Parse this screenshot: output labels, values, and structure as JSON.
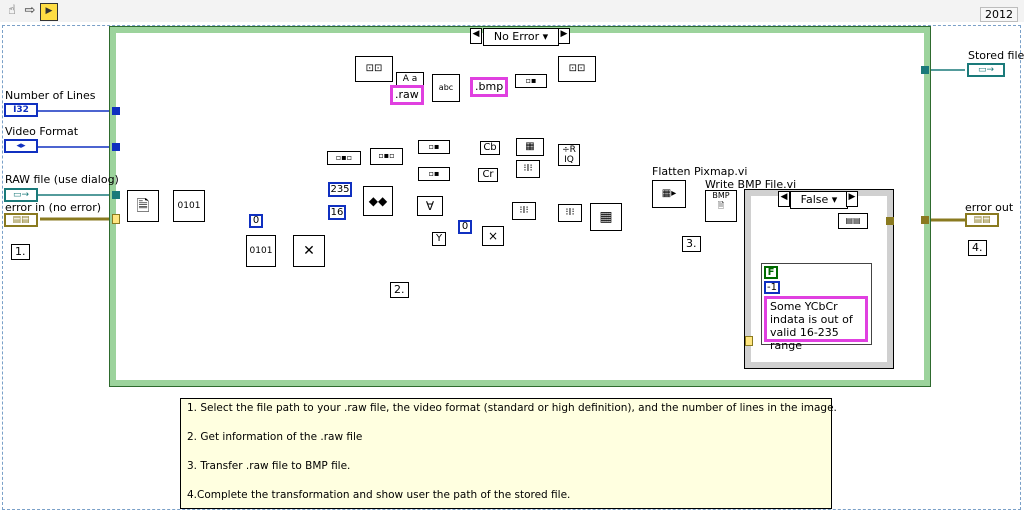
{
  "toolbar": {
    "version": "2012",
    "icons": [
      "hand-tool-icon",
      "arrow-right-icon",
      "run-icon"
    ]
  },
  "controls": {
    "number_of_lines": {
      "label": "Number of Lines",
      "type": "I32"
    },
    "video_format": {
      "label": "Video Format"
    },
    "raw_file": {
      "label": "RAW file (use dialog)"
    },
    "error_in": {
      "label": "error in (no error)"
    }
  },
  "indicators": {
    "stored_file": {
      "label": "Stored file"
    },
    "error_out": {
      "label": "error out"
    }
  },
  "case_structure": {
    "selector": "No Error",
    "step_label": "2."
  },
  "inner_case": {
    "selector": "False",
    "bool_const": "F",
    "num_const": "-1",
    "message": "Some YCbCr indata is out of valid 16-235 range"
  },
  "constants": {
    "zero_a": "0",
    "zero_b": "0",
    "c235": "235",
    "c16": "16",
    "ext_raw": ".raw",
    "ext_bmp": ".bmp",
    "cb": "Cb",
    "cr": "Cr",
    "y": "Y"
  },
  "subvis": {
    "flatten": "Flatten Pixmap.vi",
    "write_bmp": "Write BMP File.vi",
    "bmp_tag": "BMP"
  },
  "step_labels": {
    "s1": "1.",
    "s3": "3.",
    "s4": "4."
  },
  "comment": {
    "line1": "1. Select the file path to your .raw file, the video format (standard or high definition), and the number of lines in the image.",
    "line2": "2. Get information of the .raw file",
    "line3": "3. Transfer .raw file to BMP file.",
    "line4": "4.Complete the transformation and show user the path of the stored file."
  },
  "colors": {
    "case_green": "#9cd39c",
    "wire_blue": "#1030c0",
    "wire_teal": "#1a7a7a",
    "wire_error": "#8a7a20",
    "string_pink": "#e040e0"
  }
}
